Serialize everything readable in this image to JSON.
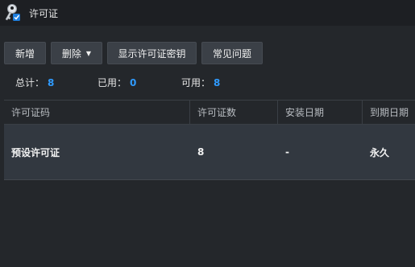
{
  "window": {
    "title": "许可证"
  },
  "toolbar": {
    "add_label": "新增",
    "delete_label": "删除",
    "show_key_label": "显示许可证密钥",
    "faq_label": "常见问题"
  },
  "stats": {
    "total_label": "总计：",
    "total_value": "8",
    "used_label": "已用：",
    "used_value": "0",
    "available_label": "可用：",
    "available_value": "8"
  },
  "table": {
    "columns": [
      "许可证码",
      "许可证数",
      "安装日期",
      "到期日期"
    ],
    "rows": [
      {
        "code": "预设许可证",
        "count": "8",
        "install_date": "-",
        "expiry_date": "永久"
      }
    ]
  },
  "colors": {
    "accent": "#2f9bff",
    "background": "#24272b",
    "titlebar": "#1d1f23",
    "row_bg": "#323840"
  }
}
